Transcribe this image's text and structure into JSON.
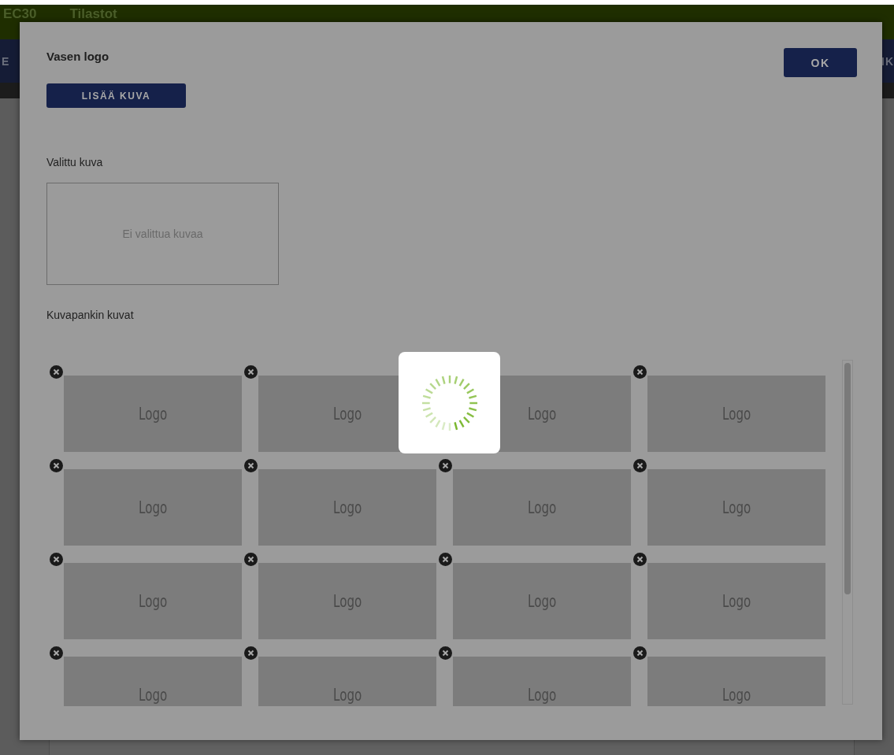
{
  "background": {
    "top_bar": [
      "EC30",
      "Tilastot"
    ],
    "nav_bar": [
      "E",
      "IK"
    ]
  },
  "dialog": {
    "title": "Vasen logo",
    "add_button": "LISÄÄ KUVA",
    "ok_button": "OK",
    "selected_label": "Valittu kuva",
    "empty_text": "Ei valittua kuvaa",
    "bank_label": "Kuvapankin kuvat",
    "loading": true,
    "images": [
      {
        "label": "Logo",
        "delete_visible": true
      },
      {
        "label": "Logo",
        "delete_visible": true
      },
      {
        "label": "Logo",
        "delete_visible": false
      },
      {
        "label": "Logo",
        "delete_visible": true
      },
      {
        "label": "Logo",
        "delete_visible": true
      },
      {
        "label": "Logo",
        "delete_visible": true
      },
      {
        "label": "Logo",
        "delete_visible": true
      },
      {
        "label": "Logo",
        "delete_visible": true
      },
      {
        "label": "Logo",
        "delete_visible": true
      },
      {
        "label": "Logo",
        "delete_visible": true
      },
      {
        "label": "Logo",
        "delete_visible": true
      },
      {
        "label": "Logo",
        "delete_visible": true
      },
      {
        "label": "Logo",
        "delete_visible": true
      },
      {
        "label": "Logo",
        "delete_visible": true
      },
      {
        "label": "Logo",
        "delete_visible": true
      },
      {
        "label": "Logo",
        "delete_visible": true
      }
    ]
  }
}
